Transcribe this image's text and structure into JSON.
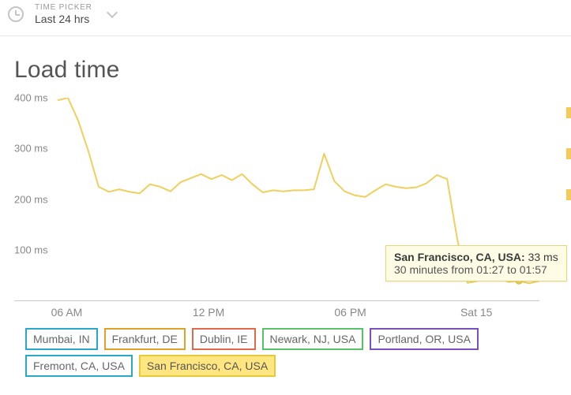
{
  "timepicker": {
    "label": "TIME PICKER",
    "value": "Last 24 hrs"
  },
  "chart": {
    "title": "Load time"
  },
  "chart_data": {
    "type": "line",
    "title": "Load time",
    "xlabel": "",
    "ylabel": "",
    "ylim": [
      0,
      400
    ],
    "y_ticks": [
      "100 ms",
      "200 ms",
      "300 ms",
      "400 ms"
    ],
    "x_ticks": [
      "06 AM",
      "12 PM",
      "06 PM",
      "Sat 15"
    ],
    "series": [
      {
        "name": "San Francisco, CA, USA",
        "color": "#e8c93a",
        "x": [
          0,
          1,
          2,
          3,
          4,
          5,
          6,
          7,
          8,
          9,
          10,
          11,
          12,
          13,
          14,
          15,
          16,
          17,
          18,
          19,
          20,
          21,
          22,
          23,
          24,
          25,
          26,
          27,
          28,
          29,
          30,
          31,
          32,
          33,
          34,
          35,
          36,
          37,
          38,
          39,
          40,
          41,
          42,
          43,
          44,
          45,
          46,
          47
        ],
        "values": [
          395,
          400,
          355,
          295,
          225,
          215,
          220,
          215,
          212,
          230,
          225,
          216,
          234,
          242,
          250,
          240,
          248,
          238,
          250,
          230,
          214,
          218,
          216,
          218,
          218,
          220,
          290,
          236,
          216,
          208,
          205,
          218,
          230,
          225,
          222,
          224,
          232,
          248,
          240,
          120,
          36,
          40,
          55,
          45,
          38,
          40,
          35,
          40
        ]
      }
    ],
    "highlight_point": {
      "x": 45,
      "y": 40
    },
    "legend_entries": [
      {
        "name": "Mumbai, IN",
        "color": "#2aa8c9"
      },
      {
        "name": "Frankfurt, DE",
        "color": "#e0a12b"
      },
      {
        "name": "Dublin, IE",
        "color": "#e06a4a"
      },
      {
        "name": "Newark, NJ, USA",
        "color": "#56c26a"
      },
      {
        "name": "Portland, OR, USA",
        "color": "#7a4fbf"
      },
      {
        "name": "Fremont, CA, USA",
        "color": "#2aa8c9"
      },
      {
        "name": "San Francisco, CA, USA",
        "color": "#e8c93a",
        "active": true
      }
    ]
  },
  "tooltip": {
    "series": "San Francisco, CA, USA:",
    "value": "33 ms",
    "sub": "30 minutes from 01:27 to 01:57"
  },
  "legend": {
    "items": [
      {
        "label": "Mumbai, IN"
      },
      {
        "label": "Frankfurt, DE"
      },
      {
        "label": "Dublin, IE"
      },
      {
        "label": "Newark, NJ, USA"
      },
      {
        "label": "Portland, OR, USA"
      },
      {
        "label": "Fremont, CA, USA"
      },
      {
        "label": "San Francisco, CA, USA"
      }
    ]
  }
}
